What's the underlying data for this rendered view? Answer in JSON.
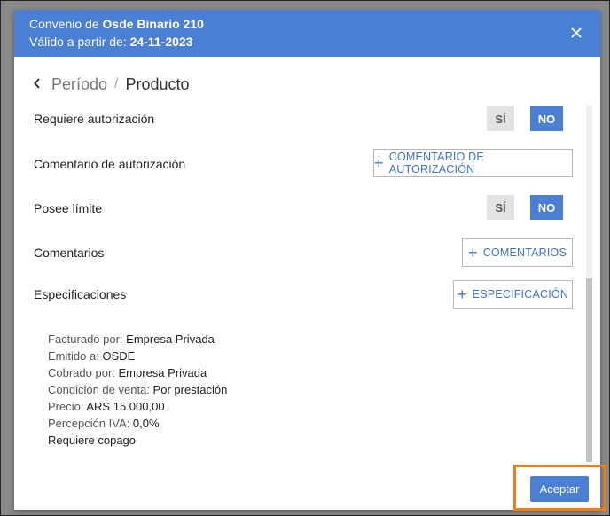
{
  "header": {
    "title_prefix": "Convenio de",
    "title_name": "Osde Binario 210",
    "valid_prefix": "Válido a partir de:",
    "valid_date": "24-11-2023",
    "close_icon": "close-icon"
  },
  "breadcrumb": {
    "back_icon": "chevron-left-icon",
    "previous": "Período",
    "separator": "/",
    "current": "Producto"
  },
  "rows": {
    "requiere_autorizacion": {
      "label": "Requiere autorización",
      "yes": "SÍ",
      "no": "NO",
      "selected": "NO"
    },
    "comentario_autorizacion": {
      "label": "Comentario de autorización",
      "button": "COMENTARIO DE AUTORIZACIÓN"
    },
    "posee_limite": {
      "label": "Posee límite",
      "yes": "SÍ",
      "no": "NO",
      "selected": "NO"
    },
    "comentarios": {
      "label": "Comentarios",
      "button": "COMENTARIOS"
    },
    "especificaciones": {
      "label": "Especificaciones",
      "button": "ESPECIFICACIÓN"
    }
  },
  "details": {
    "facturado_label": "Facturado por:",
    "facturado_value": "Empresa Privada",
    "emitido_label": "Emitido a:",
    "emitido_value": "OSDE",
    "cobrado_label": "Cobrado por:",
    "cobrado_value": "Empresa Privada",
    "condicion_label": "Condición de venta:",
    "condicion_value": "Por prestación",
    "precio_label": "Precio:",
    "precio_value": "ARS 15.000,00",
    "percepcion_label": "Percepción IVA:",
    "percepcion_value": "0,0%",
    "copago": "Requiere copago"
  },
  "footer": {
    "accept_label": "Aceptar"
  },
  "colors": {
    "accent": "#4a7fd4",
    "highlight": "#f07d16"
  }
}
